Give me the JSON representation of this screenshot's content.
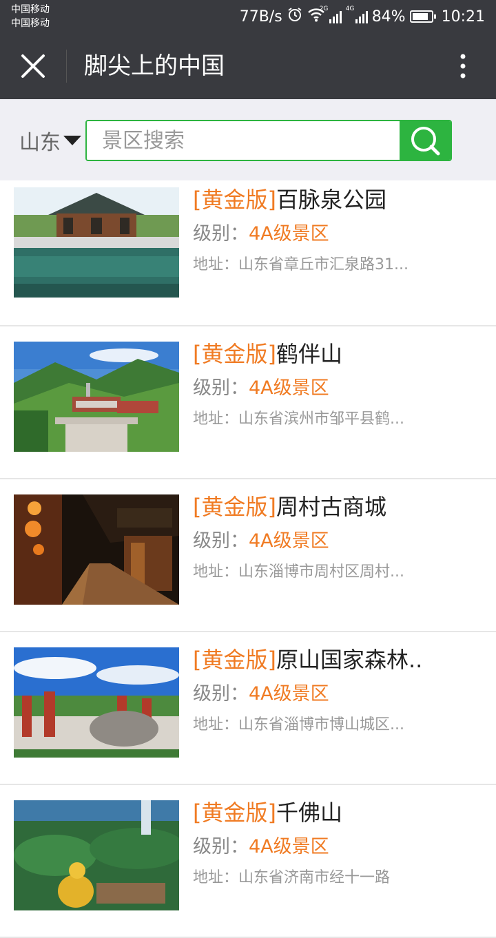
{
  "status": {
    "carrier1": "中国移动",
    "carrier2": "中国移动",
    "speed": "77B/s",
    "net1": "2G",
    "net2": "4G",
    "battery": "84%",
    "battery_level": 0.84,
    "time": "10:21"
  },
  "appbar": {
    "title": "脚尖上的中国",
    "close_icon": "close-icon",
    "more_icon": "more-vertical-icon"
  },
  "search": {
    "region": "山东",
    "placeholder": "景区搜索",
    "accent": "#2db440"
  },
  "colors": {
    "header_bg": "#393a3f",
    "accent_orange": "#f07b23"
  },
  "list": [
    {
      "badge": "[黄金版]",
      "name": "百脉泉公园",
      "level_label": "级别：",
      "level": "4A级景区",
      "address": "地址：山东省章丘市汇泉路31..."
    },
    {
      "badge": "[黄金版]",
      "name": "鹤伴山",
      "level_label": "级别：",
      "level": "4A级景区",
      "address": "地址：山东省滨州市邹平县鹤..."
    },
    {
      "badge": "[黄金版]",
      "name": "周村古商城",
      "level_label": "级别：",
      "level": "4A级景区",
      "address": "地址：山东淄博市周村区周村..."
    },
    {
      "badge": "[黄金版]",
      "name": "原山国家森林..",
      "level_label": "级别：",
      "level": "4A级景区",
      "address": "地址：山东省淄博市博山城区..."
    },
    {
      "badge": "[黄金版]",
      "name": "千佛山",
      "level_label": "级别：",
      "level": "4A级景区",
      "address": "地址：山东省济南市经十一路"
    }
  ]
}
